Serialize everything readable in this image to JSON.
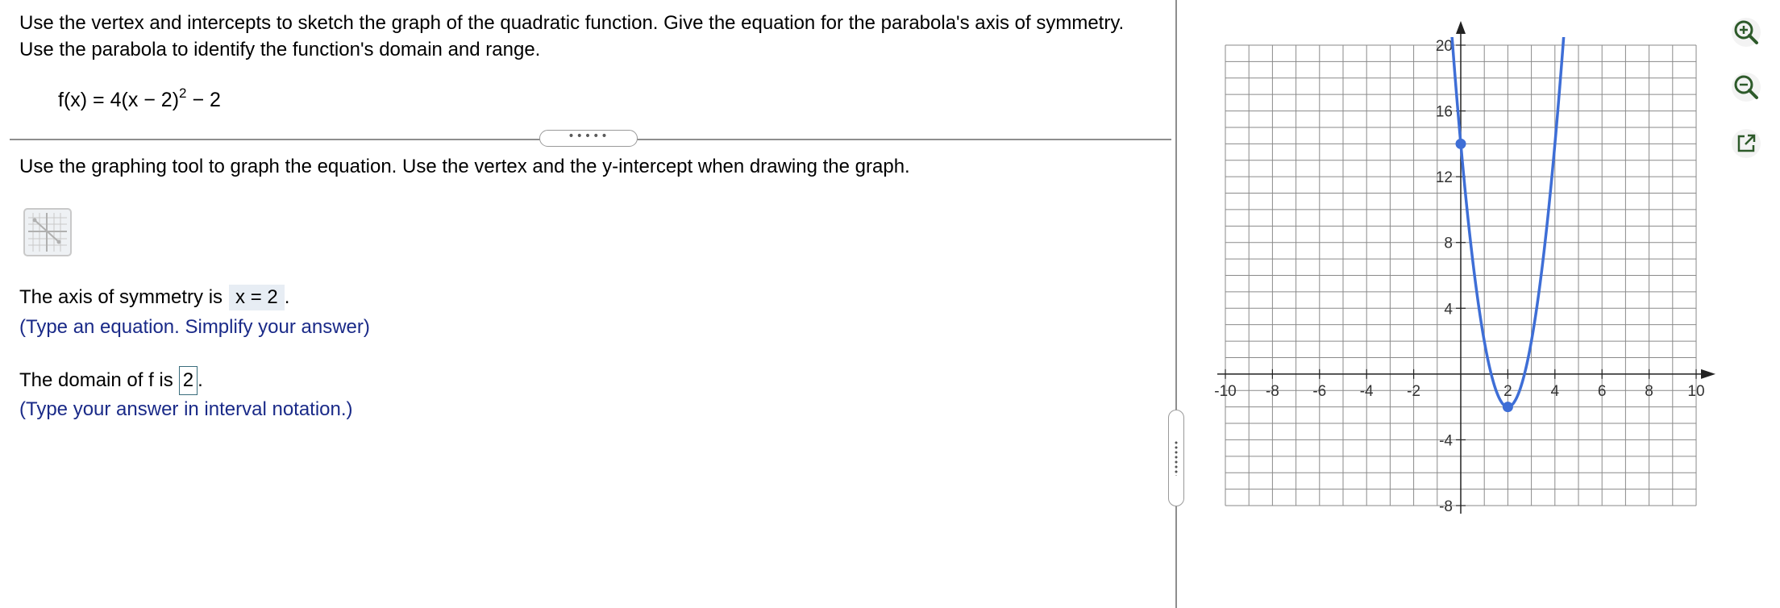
{
  "question": {
    "prompt": "Use the vertex and intercepts to sketch the graph of the quadratic function. Give the equation for the parabola's axis of symmetry.  Use the parabola to identify the function's domain and range.",
    "equation_main": "f(x) = 4(x − 2)",
    "equation_exp": "2",
    "equation_tail": " − 2",
    "more_button": "•••••"
  },
  "instructions": "Use the graphing tool to graph the equation. Use the vertex and the y-intercept when drawing the graph.",
  "graph_tool": {
    "icon": "graph-tool-icon"
  },
  "axis_of_symmetry": {
    "label": "The axis of symmetry is",
    "answer": "x = 2",
    "end": ".",
    "hint": "(Type an equation. Simplify your answer)"
  },
  "domain": {
    "label": "The domain of f is",
    "answer": "2",
    "end": ".",
    "hint": "(Type your answer in interval notation.)"
  },
  "toolbar": {
    "zoom_in_icon": "zoom-in-icon",
    "zoom_out_icon": "zoom-out-icon",
    "popout_icon": "popout-icon"
  },
  "colors": {
    "curve": "#3e6ed6",
    "hint": "#1a2a88",
    "zoom_icon": "#2d5a2a"
  },
  "chart_data": {
    "type": "line",
    "title": "",
    "xlabel": "",
    "ylabel": "",
    "xlim": [
      -10,
      10
    ],
    "ylim": [
      -8,
      20
    ],
    "x_grid_step": 1,
    "y_grid_step": 1,
    "x_ticks": [
      -10,
      -8,
      -6,
      -4,
      -2,
      2,
      4,
      6,
      8,
      10
    ],
    "y_ticks": [
      -8,
      -4,
      4,
      8,
      12,
      16,
      20
    ],
    "x_tick_labels": [
      "-10",
      "-8",
      "-6",
      "-4",
      "-2",
      "2",
      "4",
      "6",
      "8",
      "10"
    ],
    "y_tick_labels": [
      "-8",
      "-4",
      "4",
      "8",
      "12",
      "16",
      "20"
    ],
    "grid": true,
    "series": [
      {
        "function": "4(x-2)^2-2",
        "x": [
          -0.4,
          0,
          0.5,
          1,
          1.5,
          2,
          2.5,
          3,
          3.5,
          4,
          4.4
        ],
        "y": [
          21.04,
          14,
          7,
          2,
          -1,
          -2,
          -1,
          2,
          7,
          14,
          21.04
        ],
        "color": "#3e6ed6"
      }
    ],
    "points": [
      {
        "x": 0,
        "y": 14
      },
      {
        "x": 2,
        "y": -2
      }
    ]
  }
}
